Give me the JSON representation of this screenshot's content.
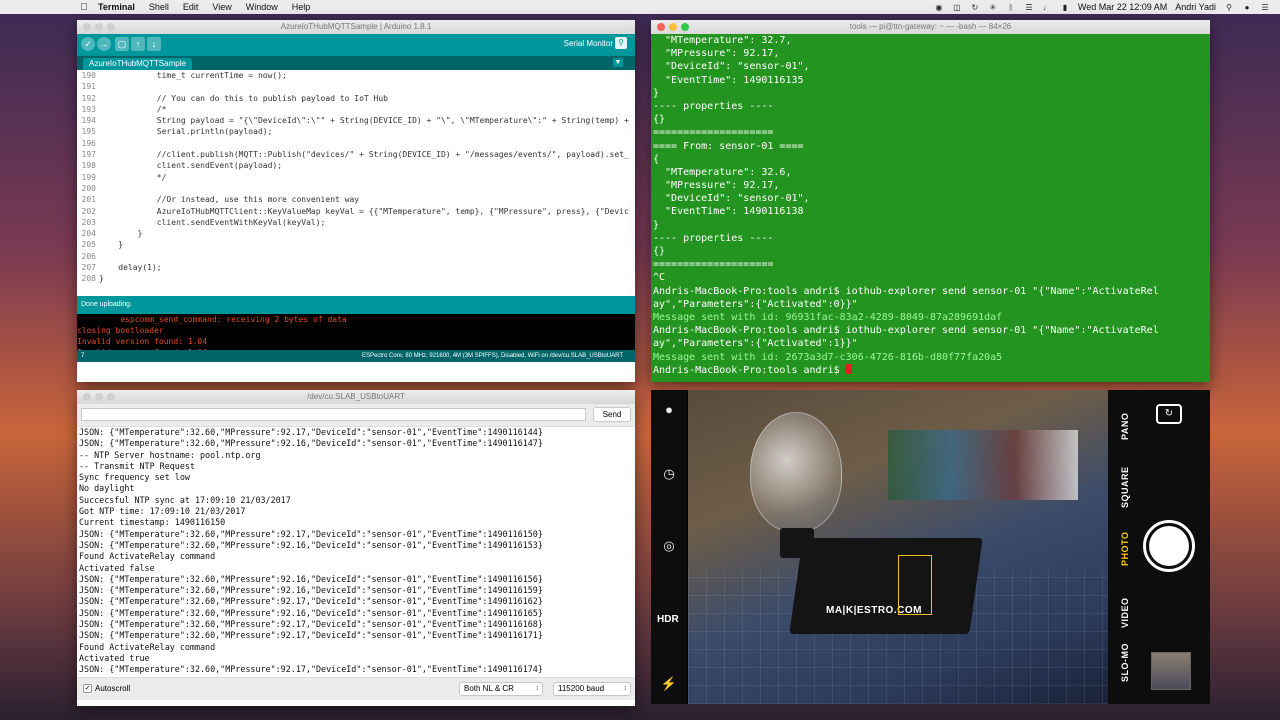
{
  "menubar": {
    "app": "Terminal",
    "items": [
      "Shell",
      "Edit",
      "View",
      "Window",
      "Help"
    ],
    "clock": "Wed Mar 22  12:09 AM",
    "user": "Andri Yadi"
  },
  "arduino": {
    "title": "AzureIoTHubMQTTSample | Arduino 1.8.1",
    "serial_monitor_label": "Serial Monitor",
    "tab": "AzureIoTHubMQTTSample",
    "code_lines": [
      {
        "n": "190",
        "t": "            time_t currentTime = now();"
      },
      {
        "n": "191",
        "t": ""
      },
      {
        "n": "192",
        "t": "            // You can do this to publish payload to IoT Hub"
      },
      {
        "n": "193",
        "t": "            /*"
      },
      {
        "n": "194",
        "t": "            String payload = \"{\\\"DeviceId\\\":\\\"\" + String(DEVICE_ID) + \"\\\", \\\"MTemperature\\\":\" + String(temp) +"
      },
      {
        "n": "195",
        "t": "            Serial.println(payload);"
      },
      {
        "n": "196",
        "t": ""
      },
      {
        "n": "197",
        "t": "            //client.publish(MQTT::Publish(\"devices/\" + String(DEVICE_ID) + \"/messages/events/\", payload).set_"
      },
      {
        "n": "198",
        "t": "            client.sendEvent(payload);"
      },
      {
        "n": "199",
        "t": "            */"
      },
      {
        "n": "200",
        "t": ""
      },
      {
        "n": "201",
        "t": "            //Or instead, use this more convenient way"
      },
      {
        "n": "202",
        "t": "            AzureIoTHubMQTTClient::KeyValueMap keyVal = {{\"MTemperature\", temp}, {\"MPressure\", press}, {\"Devic"
      },
      {
        "n": "203",
        "t": "            client.sendEventWithKeyVal(keyVal);"
      },
      {
        "n": "204",
        "t": "        }"
      },
      {
        "n": "205",
        "t": "    }"
      },
      {
        "n": "206",
        "t": ""
      },
      {
        "n": "207",
        "t": "    delay(1);"
      },
      {
        "n": "208",
        "t": "}"
      }
    ],
    "status": "Done uploading.",
    "console": [
      "         espcomm_send_command: receiving 2 bytes of data",
      "closing bootloader",
      "Invalid version found: 1.04",
      "Invalid version found: 1.04"
    ],
    "footer_line": "7",
    "footer_board": "ESPectro Core, 80 MHz, 921600, 4M (3M SPIFFS), Disabled, WiFi on /dev/cu.SLAB_USBtoUART"
  },
  "terminal": {
    "title": "tools — pi@ttn-gateway: ~ — -bash — 84×26",
    "lines": [
      {
        "t": "  \"MTemperature\": 32.7,",
        "c": ""
      },
      {
        "t": "  \"MPressure\": 92.17,",
        "c": ""
      },
      {
        "t": "  \"DeviceId\": \"sensor-01\",",
        "c": ""
      },
      {
        "t": "  \"EventTime\": 1490116135",
        "c": ""
      },
      {
        "t": "}",
        "c": ""
      },
      {
        "t": "---- properties ----",
        "c": ""
      },
      {
        "t": "{}",
        "c": ""
      },
      {
        "t": "====================",
        "c": ""
      },
      {
        "t": "==== From: sensor-01 ====",
        "c": ""
      },
      {
        "t": "{",
        "c": ""
      },
      {
        "t": "  \"MTemperature\": 32.6,",
        "c": ""
      },
      {
        "t": "  \"MPressure\": 92.17,",
        "c": ""
      },
      {
        "t": "  \"DeviceId\": \"sensor-01\",",
        "c": ""
      },
      {
        "t": "  \"EventTime\": 1490116138",
        "c": ""
      },
      {
        "t": "}",
        "c": ""
      },
      {
        "t": "---- properties ----",
        "c": ""
      },
      {
        "t": "{}",
        "c": ""
      },
      {
        "t": "====================",
        "c": ""
      },
      {
        "t": "^C",
        "c": ""
      },
      {
        "t": "Andris-MacBook-Pro:tools andri$ iothub-explorer send sensor-01 \"{\"Name\":\"ActivateRel",
        "c": ""
      },
      {
        "t": "ay\",\"Parameters\":{\"Activated\":0}}\"",
        "c": ""
      },
      {
        "t": "Message sent with id: 96931fac-83a2-4289-8049-87a289691daf",
        "c": "msg"
      },
      {
        "t": "Andris-MacBook-Pro:tools andri$ iothub-explorer send sensor-01 \"{\"Name\":\"ActivateRel",
        "c": ""
      },
      {
        "t": "ay\",\"Parameters\":{\"Activated\":1}}\"",
        "c": ""
      },
      {
        "t": "Message sent with id: 2673a3d7-c306-4726-816b-d80f77fa20a5",
        "c": "msg"
      }
    ],
    "prompt": "Andris-MacBook-Pro:tools andri$ "
  },
  "serial": {
    "title": "/dev/cu.SLAB_USBtoUART",
    "send_label": "Send",
    "input_value": "",
    "lines": [
      "JSON: {\"MTemperature\":32.60,\"MPressure\":92.17,\"DeviceId\":\"sensor-01\",\"EventTime\":1490116144}",
      "JSON: {\"MTemperature\":32.60,\"MPressure\":92.16,\"DeviceId\":\"sensor-01\",\"EventTime\":1490116147}",
      "-- NTP Server hostname: pool.ntp.org",
      "-- Transmit NTP Request",
      "Sync frequency set low",
      "No daylight",
      "Succecsful NTP sync at 17:09:10 21/03/2017",
      "Got NTP time: 17:09:10 21/03/2017",
      "Current timestamp: 1490116150",
      "JSON: {\"MTemperature\":32.60,\"MPressure\":92.17,\"DeviceId\":\"sensor-01\",\"EventTime\":1490116150}",
      "JSON: {\"MTemperature\":32.60,\"MPressure\":92.16,\"DeviceId\":\"sensor-01\",\"EventTime\":1490116153}",
      "Found ActivateRelay command",
      "Activated false",
      "JSON: {\"MTemperature\":32.60,\"MPressure\":92.16,\"DeviceId\":\"sensor-01\",\"EventTime\":1490116156}",
      "JSON: {\"MTemperature\":32.60,\"MPressure\":92.16,\"DeviceId\":\"sensor-01\",\"EventTime\":1490116159}",
      "JSON: {\"MTemperature\":32.60,\"MPressure\":92.17,\"DeviceId\":\"sensor-01\",\"EventTime\":1490116162}",
      "JSON: {\"MTemperature\":32.60,\"MPressure\":92.16,\"DeviceId\":\"sensor-01\",\"EventTime\":1490116165}",
      "JSON: {\"MTemperature\":32.60,\"MPressure\":92.17,\"DeviceId\":\"sensor-01\",\"EventTime\":1490116168}",
      "JSON: {\"MTemperature\":32.60,\"MPressure\":92.17,\"DeviceId\":\"sensor-01\",\"EventTime\":1490116171}",
      "Found ActivateRelay command",
      "Activated true",
      "JSON: {\"MTemperature\":32.60,\"MPressure\":92.17,\"DeviceId\":\"sensor-01\",\"EventTime\":1490116174}"
    ],
    "autoscroll_label": "Autoscroll",
    "line_ending": "Both NL & CR",
    "baud": "115200 baud"
  },
  "camera": {
    "modes": [
      "PANO",
      "SQUARE",
      "PHOTO",
      "VIDEO",
      "SLO-MO"
    ],
    "active_mode": "PHOTO",
    "hdr_label": "HDR",
    "box_logo": "MA|K|ESTRO.COM"
  },
  "colors": {
    "arduino_teal": "#00979c",
    "terminal_green": "#23941f",
    "console_orange": "#e34c26"
  }
}
